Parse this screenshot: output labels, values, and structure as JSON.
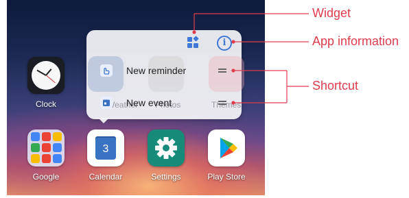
{
  "apps": {
    "clock": {
      "label": "Clock"
    },
    "google": {
      "label": "Google"
    },
    "calendar": {
      "label": "Calendar",
      "day": "3"
    },
    "settings": {
      "label": "Settings"
    },
    "play_store": {
      "label": "Play Store"
    }
  },
  "popup": {
    "shortcuts": [
      {
        "label": "New reminder",
        "icon": "reminder-hand-icon"
      },
      {
        "label": "New event",
        "icon": "calendar-event-icon"
      }
    ],
    "header_icons": [
      "widget-icon",
      "info-icon"
    ],
    "info_symbol": "i",
    "ghost_labels": [
      "Weather",
      "Photos",
      "Themes"
    ]
  },
  "annotations": {
    "widget": "Widget",
    "app_information": "App information",
    "shortcut": "Shortcut"
  },
  "colors": {
    "annotation": "#e03c4e",
    "accent_blue": "#3f78d6",
    "settings_teal": "#168b7a",
    "calendar_blue": "#3a73c4"
  }
}
